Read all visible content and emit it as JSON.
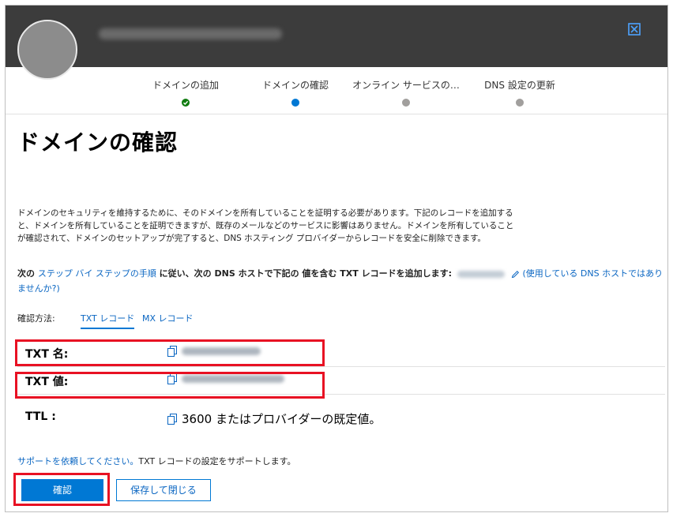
{
  "steps": [
    {
      "label": "ドメインの追加",
      "status": "done"
    },
    {
      "label": "ドメインの確認",
      "status": "current"
    },
    {
      "label": "オンライン サービスの…",
      "status": "pending"
    },
    {
      "label": "DNS 設定の更新",
      "status": "pending"
    }
  ],
  "page_title": "ドメインの確認",
  "description": "ドメインのセキュリティを維持するために、そのドメインを所有していることを証明する必要があります。下記のレコードを追加すると、ドメインを所有していることを証明できますが、既存のメールなどのサービスに影響はありません。ドメインを所有していることが確認されて、ドメインのセットアップが完了すると、DNS ホスティング プロバイダーからレコードを安全に削除できます。",
  "instruction": {
    "prefix": "次の ",
    "link": "ステップ バイ ステップの手順",
    "middle": " に従い、次の DNS ホストで下記の 値を含む TXT レコードを追加します:",
    "alt_link": "(使用している DNS ホストではありませんか?)"
  },
  "method": {
    "label": "確認方法:",
    "tabs": [
      "TXT レコード",
      "MX レコード"
    ]
  },
  "records": {
    "txt_name_label": "TXT 名:",
    "txt_value_label": "TXT 値:",
    "ttl_label": "TTL :",
    "ttl_value": "3600 またはプロバイダーの既定値。"
  },
  "support": {
    "link": "サポートを依頼してください。",
    "text": "TXT レコードの設定をサポートします。"
  },
  "buttons": {
    "verify": "確認",
    "save_close": "保存して閉じる"
  },
  "colors": {
    "header": "#3c3c3c",
    "accent": "#0078d4",
    "done": "#107c10",
    "highlight": "#e81123"
  }
}
